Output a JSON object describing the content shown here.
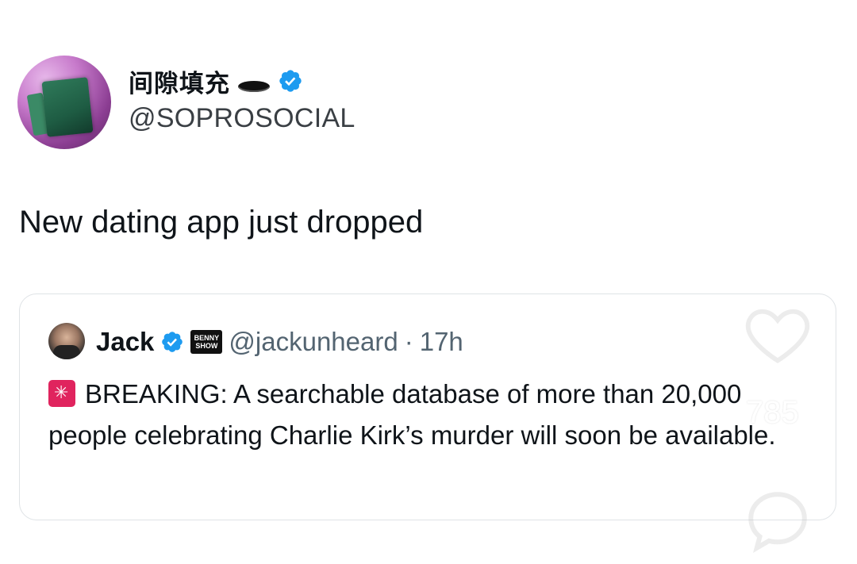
{
  "tweet": {
    "display_name": "间隙填充",
    "handle": "@SOPROSOCIAL",
    "text": "New dating app just dropped",
    "avatar_icon": "avatar-image",
    "verified_icon": "verified-badge-icon"
  },
  "quote": {
    "name": "Jack",
    "badge_text": "BENNY SHOW",
    "handle": "@jackunheard",
    "separator": "·",
    "time": "17h",
    "siren_icon": "rotating-light-icon",
    "body": "BREAKING: A searchable database of more than 20,000 people celebrating Charlie Kirk’s murder will soon be available."
  },
  "overlay": {
    "like_count": "785",
    "like_icon": "heart-icon",
    "comment_icon": "comment-bubble-icon"
  },
  "colors": {
    "verified_blue": "#1d9bf0",
    "text_primary": "#0f1419",
    "text_secondary": "#536471",
    "border": "#dfe3e6",
    "siren_red": "#e0245e"
  }
}
